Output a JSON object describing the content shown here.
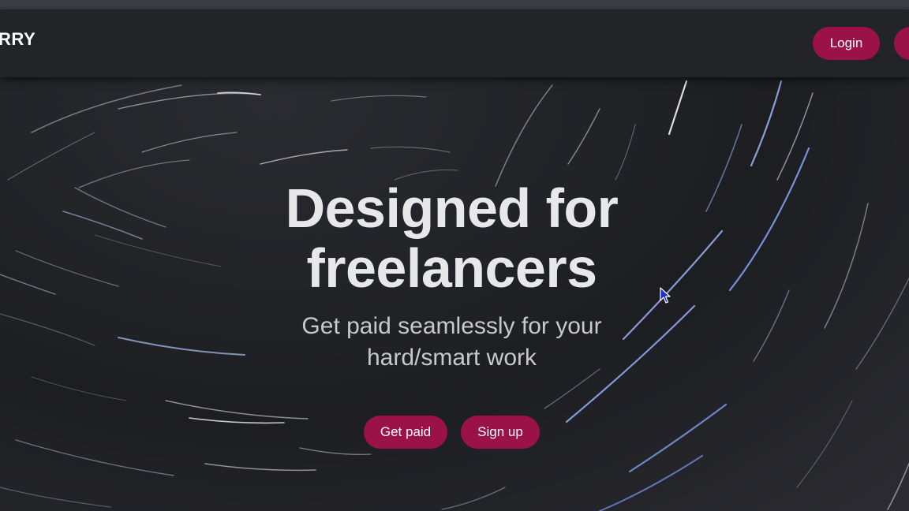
{
  "navbar": {
    "brand": "RRY",
    "login_label": "Login"
  },
  "hero": {
    "title_line1": "Designed for",
    "title_line2": "freelancers",
    "subtitle_line1": "Get paid seamlessly for your",
    "subtitle_line2": "hard/smart work",
    "get_paid_label": "Get paid",
    "sign_up_label": "Sign up"
  },
  "colors": {
    "button_bg": "#9b1248",
    "navbar_bg": "#222428",
    "hero_text": "#e8e8ea"
  },
  "icons": {
    "cursor": "mouse-pointer-icon"
  }
}
